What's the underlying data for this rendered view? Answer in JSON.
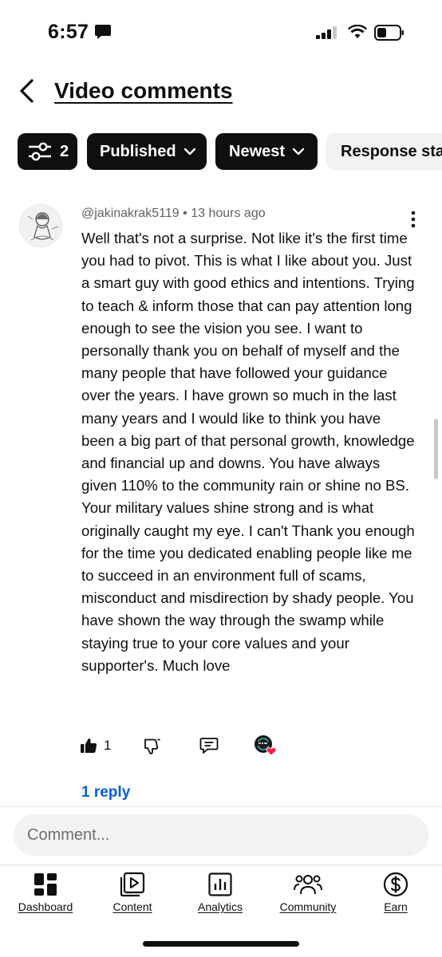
{
  "status_bar": {
    "time": "6:57"
  },
  "header": {
    "title": "Video comments"
  },
  "filters": {
    "filter_count": "2",
    "published_label": "Published",
    "sort_label": "Newest",
    "response_label": "Response sta"
  },
  "comment": {
    "author": "@jakinakrak5119",
    "separator": "•",
    "time": "13 hours ago",
    "text": "Well that's not a surprise. Not like it's the first time you had to pivot. This is what I like about you. Just a smart guy with good ethics and intentions. Trying to teach & inform those that can pay attention long enough to see the vision you see. I want to personally thank you on behalf of myself and the many people that have followed your guidance over the years. I have grown so much in the last many years and I would like to think you have been a big part of that personal growth, knowledge and financial up and downs. You have always given 110% to the community rain or shine no BS. Your military values shine strong and is what originally caught my eye. I can't Thank you enough for the time you dedicated enabling people like me to succeed in an environment full of scams, misconduct and misdirection by shady people. You have shown the way through the swamp while staying true to your core values and your supporter's. Much love",
    "like_count": "1",
    "replies_label": "1 reply"
  },
  "composer": {
    "placeholder": "Comment..."
  },
  "bottom_nav": {
    "dashboard": "Dashboard",
    "content": "Content",
    "analytics": "Analytics",
    "community": "Community",
    "earn": "Earn"
  },
  "colors": {
    "accent_blue": "#065fd4",
    "heart_red": "#ff1f4b",
    "chip_dark": "#0f0f0f",
    "chip_light": "#f2f2f2"
  }
}
